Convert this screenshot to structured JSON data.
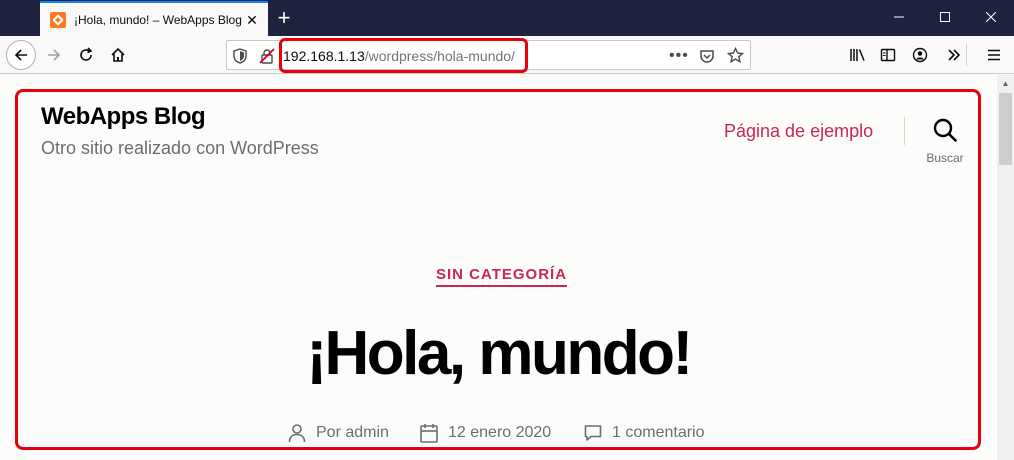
{
  "browser": {
    "tab_title": "¡Hola, mundo! – WebApps Blog",
    "url_host": "192.168.1.13",
    "url_path": "/wordpress/hola-mundo/"
  },
  "site": {
    "title": "WebApps Blog",
    "description": "Otro sitio realizado con WordPress"
  },
  "nav": {
    "link_label": "Página de ejemplo",
    "search_label": "Buscar"
  },
  "post": {
    "category": "SIN CATEGORÍA",
    "title": "¡Hola, mundo!",
    "author": "Por admin",
    "date": "12 enero 2020",
    "comments": "1 comentario"
  },
  "colors": {
    "accent": "#cd2653",
    "highlight": "#e8000d",
    "tabstrip": "#202340"
  }
}
